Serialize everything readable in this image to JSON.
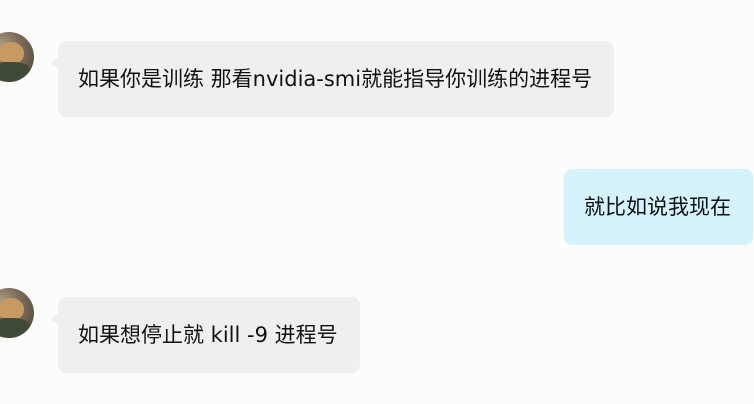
{
  "messages": [
    {
      "direction": "incoming",
      "text": "如果你是训练 那看nvidia-smi就能指导你训练的进程号"
    },
    {
      "direction": "outgoing",
      "text": "就比如说我现在"
    },
    {
      "direction": "incoming",
      "text": "如果想停止就 kill -9 进程号"
    }
  ],
  "colors": {
    "incoming_bubble": "#efefef",
    "outgoing_bubble": "#d4f3fc",
    "background": "#fcfcfc"
  }
}
